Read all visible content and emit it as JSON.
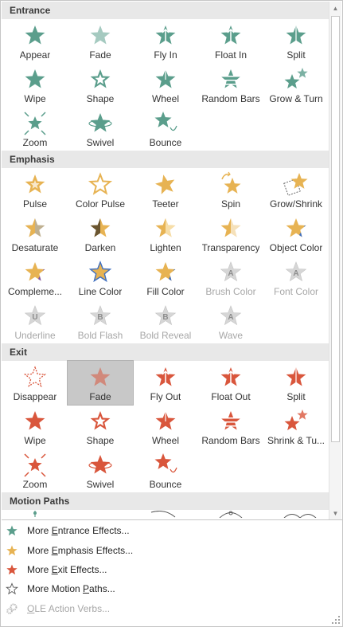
{
  "colors": {
    "entrance": "#5b9e8c",
    "emphasis": "#e7b353",
    "exit": "#d9563c",
    "disabled": "#b8b8b8",
    "section_bg": "#e8e8e8",
    "selected_bg": "#c8c8c8"
  },
  "sections": [
    {
      "key": "entrance",
      "title": "Entrance",
      "effects": [
        {
          "label": "Appear",
          "icon": "star-appear-icon",
          "disabled": false
        },
        {
          "label": "Fade",
          "icon": "star-fade-icon",
          "disabled": false
        },
        {
          "label": "Fly In",
          "icon": "star-fly-in-icon",
          "disabled": false
        },
        {
          "label": "Float In",
          "icon": "star-float-in-icon",
          "disabled": false
        },
        {
          "label": "Split",
          "icon": "star-split-icon",
          "disabled": false
        },
        {
          "label": "Wipe",
          "icon": "star-wipe-icon",
          "disabled": false
        },
        {
          "label": "Shape",
          "icon": "star-shape-icon",
          "disabled": false
        },
        {
          "label": "Wheel",
          "icon": "star-wheel-icon",
          "disabled": false
        },
        {
          "label": "Random Bars",
          "icon": "star-random-bars-icon",
          "disabled": false
        },
        {
          "label": "Grow & Turn",
          "icon": "star-grow-turn-icon",
          "disabled": false
        },
        {
          "label": "Zoom",
          "icon": "star-zoom-icon",
          "disabled": false
        },
        {
          "label": "Swivel",
          "icon": "star-swivel-icon",
          "disabled": false
        },
        {
          "label": "Bounce",
          "icon": "star-bounce-icon",
          "disabled": false
        }
      ]
    },
    {
      "key": "emphasis",
      "title": "Emphasis",
      "effects": [
        {
          "label": "Pulse",
          "icon": "star-pulse-icon",
          "disabled": false
        },
        {
          "label": "Color Pulse",
          "icon": "star-color-pulse-icon",
          "disabled": false
        },
        {
          "label": "Teeter",
          "icon": "star-teeter-icon",
          "disabled": false
        },
        {
          "label": "Spin",
          "icon": "star-spin-icon",
          "disabled": false
        },
        {
          "label": "Grow/Shrink",
          "icon": "star-grow-shrink-icon",
          "disabled": false
        },
        {
          "label": "Desaturate",
          "icon": "star-desaturate-icon",
          "disabled": false
        },
        {
          "label": "Darken",
          "icon": "star-darken-icon",
          "disabled": false
        },
        {
          "label": "Lighten",
          "icon": "star-lighten-icon",
          "disabled": false
        },
        {
          "label": "Transparency",
          "icon": "star-transparency-icon",
          "disabled": false
        },
        {
          "label": "Object Color",
          "icon": "star-object-color-icon",
          "disabled": false
        },
        {
          "label": "Compleme...",
          "icon": "star-complementary-icon",
          "disabled": false
        },
        {
          "label": "Line Color",
          "icon": "star-line-color-icon",
          "disabled": false
        },
        {
          "label": "Fill Color",
          "icon": "star-fill-color-icon",
          "disabled": false
        },
        {
          "label": "Brush Color",
          "icon": "letter-a-brush-icon",
          "disabled": true
        },
        {
          "label": "Font Color",
          "icon": "letter-a-font-icon",
          "disabled": true
        },
        {
          "label": "Underline",
          "icon": "letter-u-icon",
          "disabled": true
        },
        {
          "label": "Bold Flash",
          "icon": "letter-b-flash-icon",
          "disabled": true
        },
        {
          "label": "Bold Reveal",
          "icon": "letter-b-reveal-icon",
          "disabled": true
        },
        {
          "label": "Wave",
          "icon": "letter-a-wave-icon",
          "disabled": true
        }
      ]
    },
    {
      "key": "exit",
      "title": "Exit",
      "effects": [
        {
          "label": "Disappear",
          "icon": "star-disappear-icon",
          "disabled": false
        },
        {
          "label": "Fade",
          "icon": "star-fade-icon",
          "disabled": false,
          "selected": true
        },
        {
          "label": "Fly Out",
          "icon": "star-fly-out-icon",
          "disabled": false
        },
        {
          "label": "Float Out",
          "icon": "star-float-out-icon",
          "disabled": false
        },
        {
          "label": "Split",
          "icon": "star-split-icon",
          "disabled": false
        },
        {
          "label": "Wipe",
          "icon": "star-wipe-icon",
          "disabled": false
        },
        {
          "label": "Shape",
          "icon": "star-shape-icon",
          "disabled": false
        },
        {
          "label": "Wheel",
          "icon": "star-wheel-icon",
          "disabled": false
        },
        {
          "label": "Random Bars",
          "icon": "star-random-bars-icon",
          "disabled": false
        },
        {
          "label": "Shrink & Tu...",
          "icon": "star-shrink-turn-icon",
          "disabled": false
        },
        {
          "label": "Zoom",
          "icon": "star-zoom-icon",
          "disabled": false
        },
        {
          "label": "Swivel",
          "icon": "star-swivel-icon",
          "disabled": false
        },
        {
          "label": "Bounce",
          "icon": "star-bounce-icon",
          "disabled": false
        }
      ]
    },
    {
      "key": "motion",
      "title": "Motion Paths",
      "effects": []
    }
  ],
  "footer": {
    "items": [
      {
        "pre": "More ",
        "key": "E",
        "post": "ntrance Effects...",
        "icon": "star-entrance-icon",
        "color": "#5b9e8c",
        "disabled": false
      },
      {
        "pre": "More ",
        "key": "E",
        "post": "mphasis Effects...",
        "icon": "star-emphasis-icon",
        "color": "#e7b353",
        "disabled": false
      },
      {
        "pre": "More ",
        "key": "E",
        "post": "xit Effects...",
        "icon": "star-exit-icon",
        "color": "#d9563c",
        "disabled": false
      },
      {
        "pre": "More Motion ",
        "key": "P",
        "post": "aths...",
        "icon": "star-outline-icon",
        "color": "#555555",
        "disabled": false
      },
      {
        "pre": "",
        "key": "O",
        "post": "LE Action Verbs...",
        "icon": "gears-icon",
        "color": "#b8b8b8",
        "disabled": true
      }
    ]
  }
}
